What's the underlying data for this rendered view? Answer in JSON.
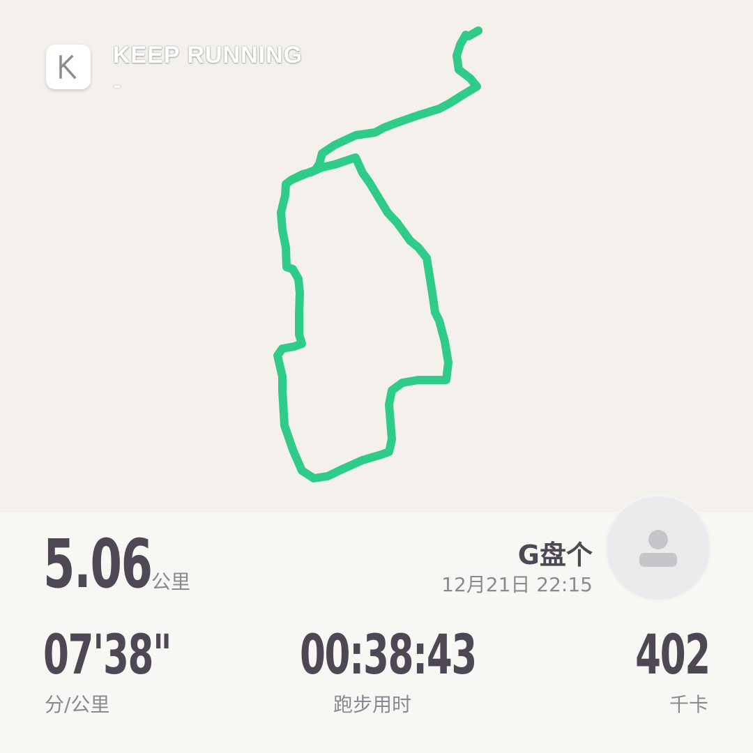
{
  "header": {
    "app_name": "KEEP RUNNING",
    "sub_text": "-",
    "logo_icon": "keep-k-logo-icon"
  },
  "route": {
    "color": "#2ecc88"
  },
  "user": {
    "name": "G盘个",
    "datetime": "12月21日 22:15",
    "avatar_icon": "user-placeholder-icon"
  },
  "stats": {
    "distance": {
      "value": "5.06",
      "unit": "公里"
    },
    "pace": {
      "value": "07'38\"",
      "unit": "分/公里"
    },
    "duration": {
      "value": "00:38:43",
      "unit": "跑步用时"
    },
    "calories": {
      "value": "402",
      "unit": "千卡"
    }
  },
  "colors": {
    "stat_text": "#4e4854",
    "unit_text": "#8c8890",
    "map_bg": "#f4f1ec"
  }
}
